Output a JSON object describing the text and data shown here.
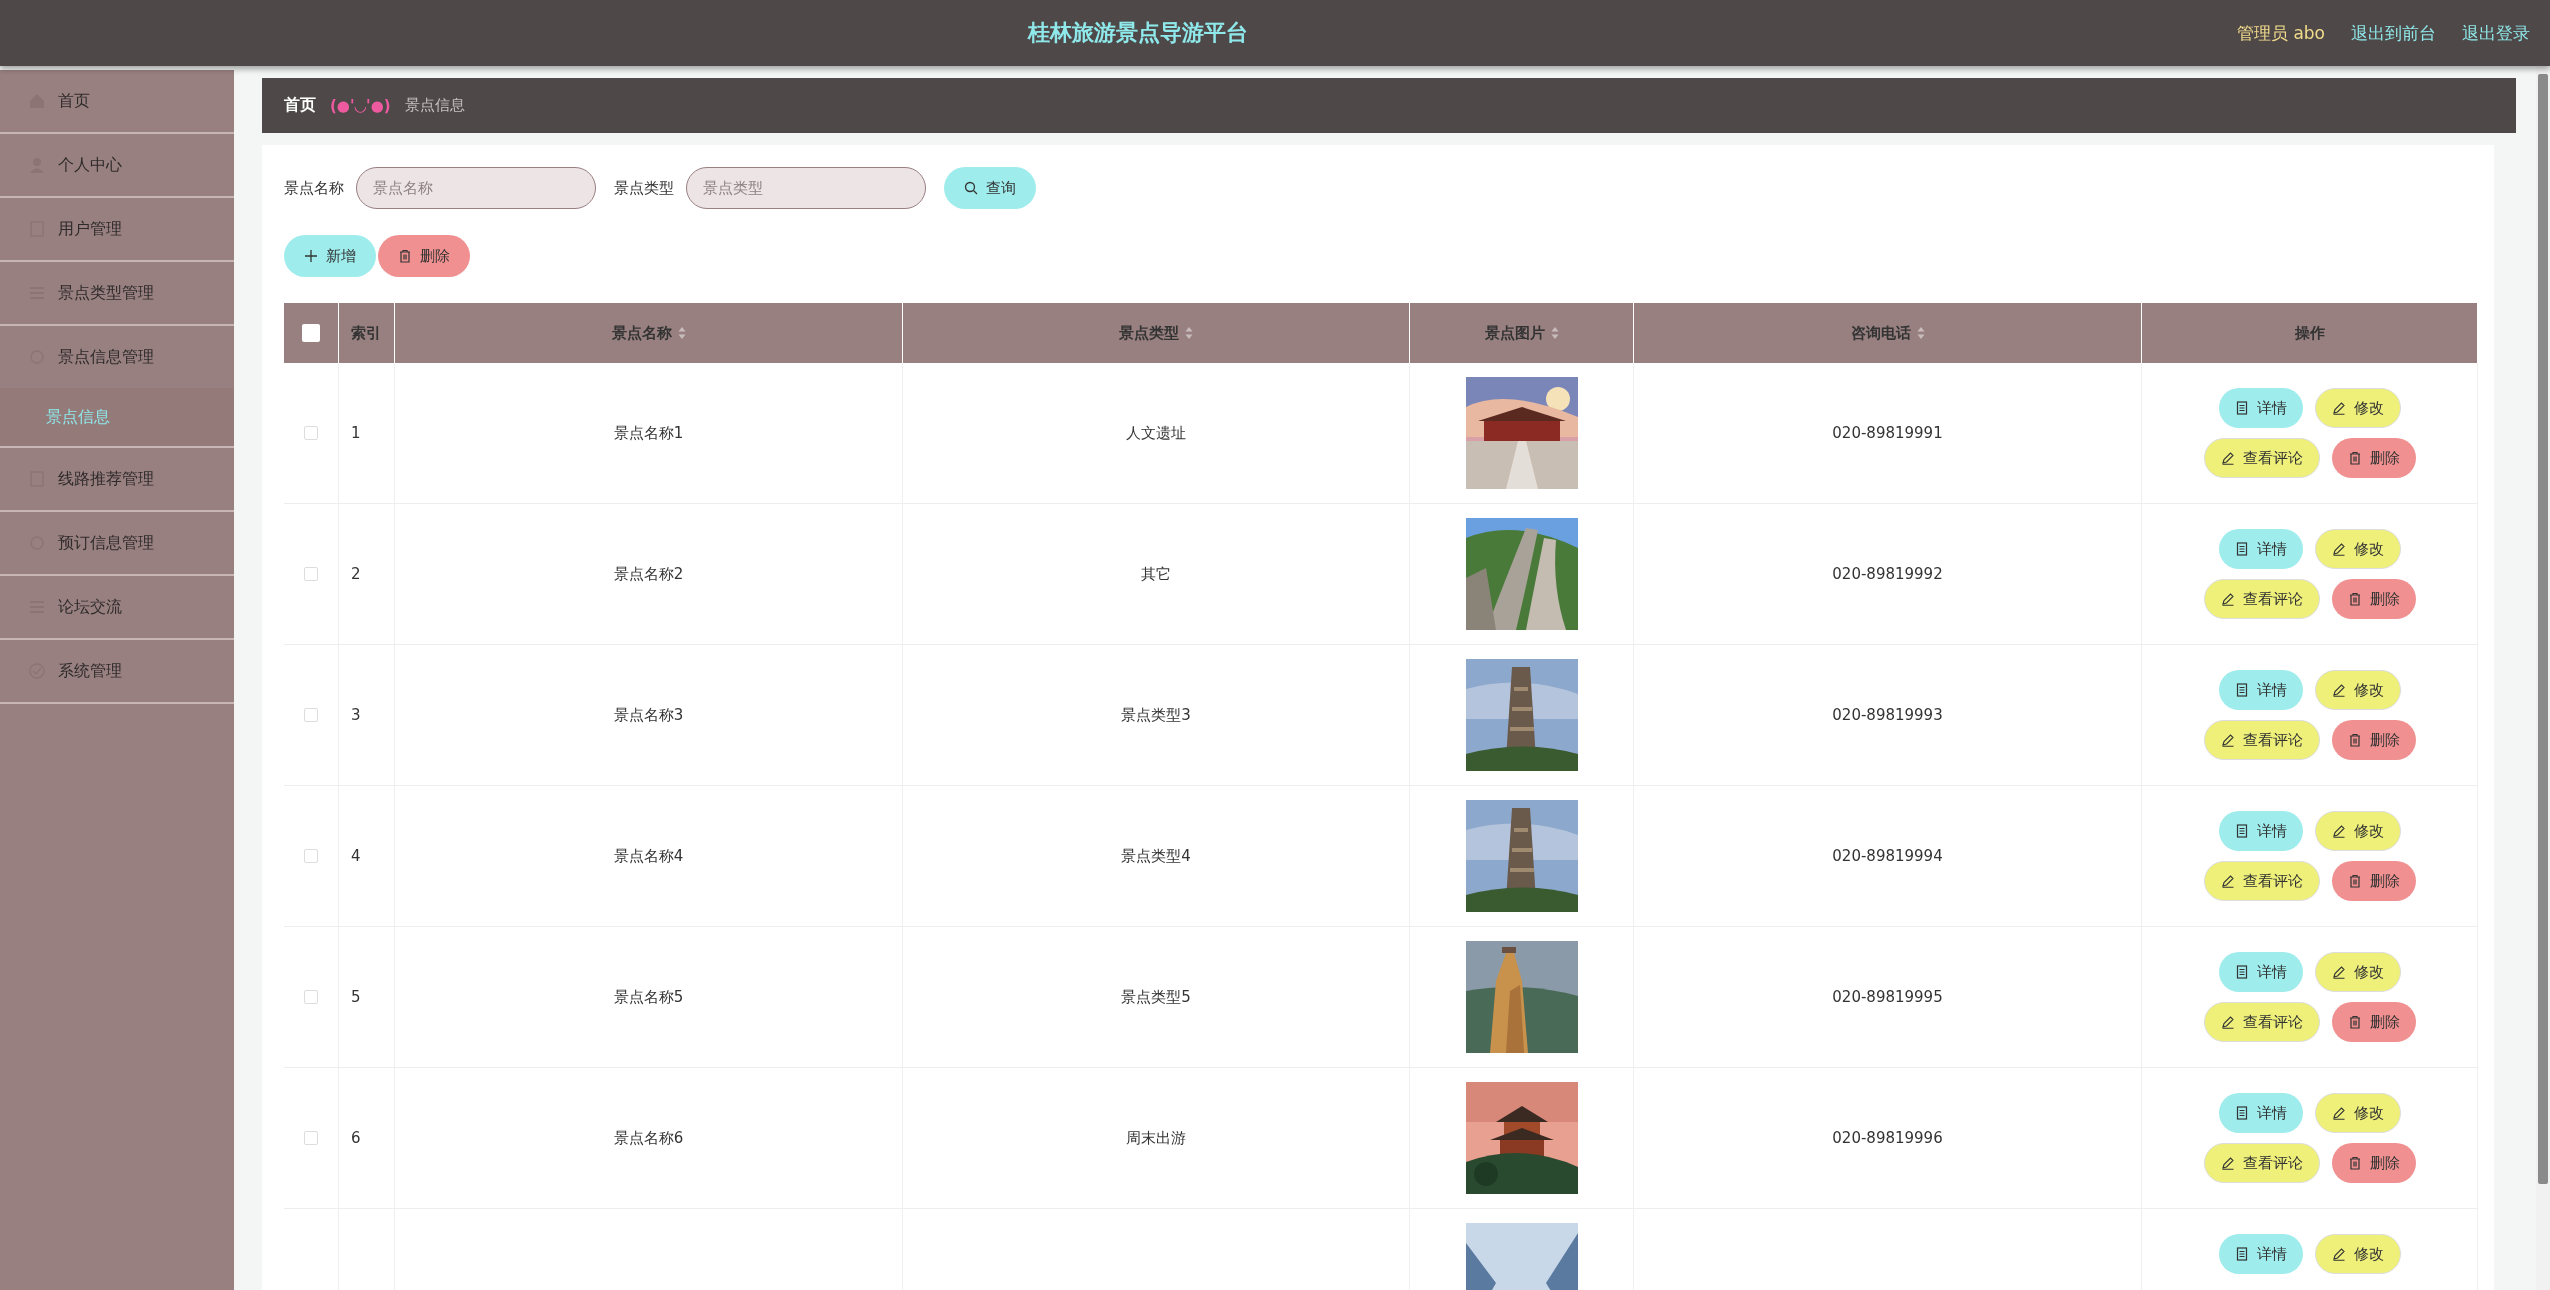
{
  "header": {
    "title": "桂林旅游景点导游平台",
    "user": "管理员 abo",
    "links": [
      "退出到前台",
      "退出登录"
    ]
  },
  "sidebar": {
    "items": [
      {
        "label": "首页",
        "selected": false
      },
      {
        "label": "个人中心",
        "selected": false
      },
      {
        "label": "用户管理",
        "selected": false
      },
      {
        "label": "景点类型管理",
        "selected": false
      },
      {
        "label": "景点信息管理",
        "selected": false,
        "expanded": true,
        "children": [
          {
            "label": "景点信息",
            "selected": true
          }
        ]
      },
      {
        "label": "线路推荐管理",
        "selected": false
      },
      {
        "label": "预订信息管理",
        "selected": false
      },
      {
        "label": "论坛交流",
        "selected": false
      },
      {
        "label": "系统管理",
        "selected": false
      }
    ]
  },
  "breadcrumb": {
    "home": "首页",
    "separator": "(●'◡'●)",
    "current": "景点信息"
  },
  "search": {
    "fields": [
      {
        "label": "景点名称",
        "placeholder": "景点名称"
      },
      {
        "label": "景点类型",
        "placeholder": "景点类型"
      }
    ],
    "button": "查询"
  },
  "toolbar": [
    {
      "label": "新增",
      "kind": "add"
    },
    {
      "label": "删除",
      "kind": "delete"
    }
  ],
  "table": {
    "columns": [
      {
        "label": "索引",
        "sortable": false
      },
      {
        "label": "景点名称",
        "sortable": true
      },
      {
        "label": "景点类型",
        "sortable": true
      },
      {
        "label": "景点图片",
        "sortable": true
      },
      {
        "label": "咨询电话",
        "sortable": true
      },
      {
        "label": "操作",
        "sortable": false
      }
    ],
    "all_checked": false,
    "rows": [
      {
        "checked": false,
        "index": "1",
        "name": "景点名称1",
        "type": "人文遗址",
        "phone": "020-89819991",
        "actions": [
          {
            "label": "详情",
            "kind": "detail"
          },
          {
            "label": "修改",
            "kind": "edit"
          },
          {
            "label": "查看评论",
            "kind": "comment"
          },
          {
            "label": "删除",
            "kind": "delete"
          }
        ]
      },
      {
        "checked": false,
        "index": "2",
        "name": "景点名称2",
        "type": "其它",
        "phone": "020-89819992",
        "actions": [
          {
            "label": "详情",
            "kind": "detail"
          },
          {
            "label": "修改",
            "kind": "edit"
          },
          {
            "label": "查看评论",
            "kind": "comment"
          },
          {
            "label": "删除",
            "kind": "delete"
          }
        ]
      },
      {
        "checked": false,
        "index": "3",
        "name": "景点名称3",
        "type": "景点类型3",
        "phone": "020-89819993",
        "actions": [
          {
            "label": "详情",
            "kind": "detail"
          },
          {
            "label": "修改",
            "kind": "edit"
          },
          {
            "label": "查看评论",
            "kind": "comment"
          },
          {
            "label": "删除",
            "kind": "delete"
          }
        ]
      },
      {
        "checked": false,
        "index": "4",
        "name": "景点名称4",
        "type": "景点类型4",
        "phone": "020-89819994",
        "actions": [
          {
            "label": "详情",
            "kind": "detail"
          },
          {
            "label": "修改",
            "kind": "edit"
          },
          {
            "label": "查看评论",
            "kind": "comment"
          },
          {
            "label": "删除",
            "kind": "delete"
          }
        ]
      },
      {
        "checked": false,
        "index": "5",
        "name": "景点名称5",
        "type": "景点类型5",
        "phone": "020-89819995",
        "actions": [
          {
            "label": "详情",
            "kind": "detail"
          },
          {
            "label": "修改",
            "kind": "edit"
          },
          {
            "label": "查看评论",
            "kind": "comment"
          },
          {
            "label": "删除",
            "kind": "delete"
          }
        ]
      },
      {
        "checked": false,
        "index": "6",
        "name": "景点名称6",
        "type": "周末出游",
        "phone": "020-89819996",
        "actions": [
          {
            "label": "详情",
            "kind": "detail"
          },
          {
            "label": "修改",
            "kind": "edit"
          },
          {
            "label": "查看评论",
            "kind": "comment"
          },
          {
            "label": "删除",
            "kind": "delete"
          }
        ]
      },
      {
        "actions": [
          {
            "label": "详情",
            "kind": "detail"
          },
          {
            "label": "修改",
            "kind": "edit"
          }
        ]
      }
    ]
  }
}
